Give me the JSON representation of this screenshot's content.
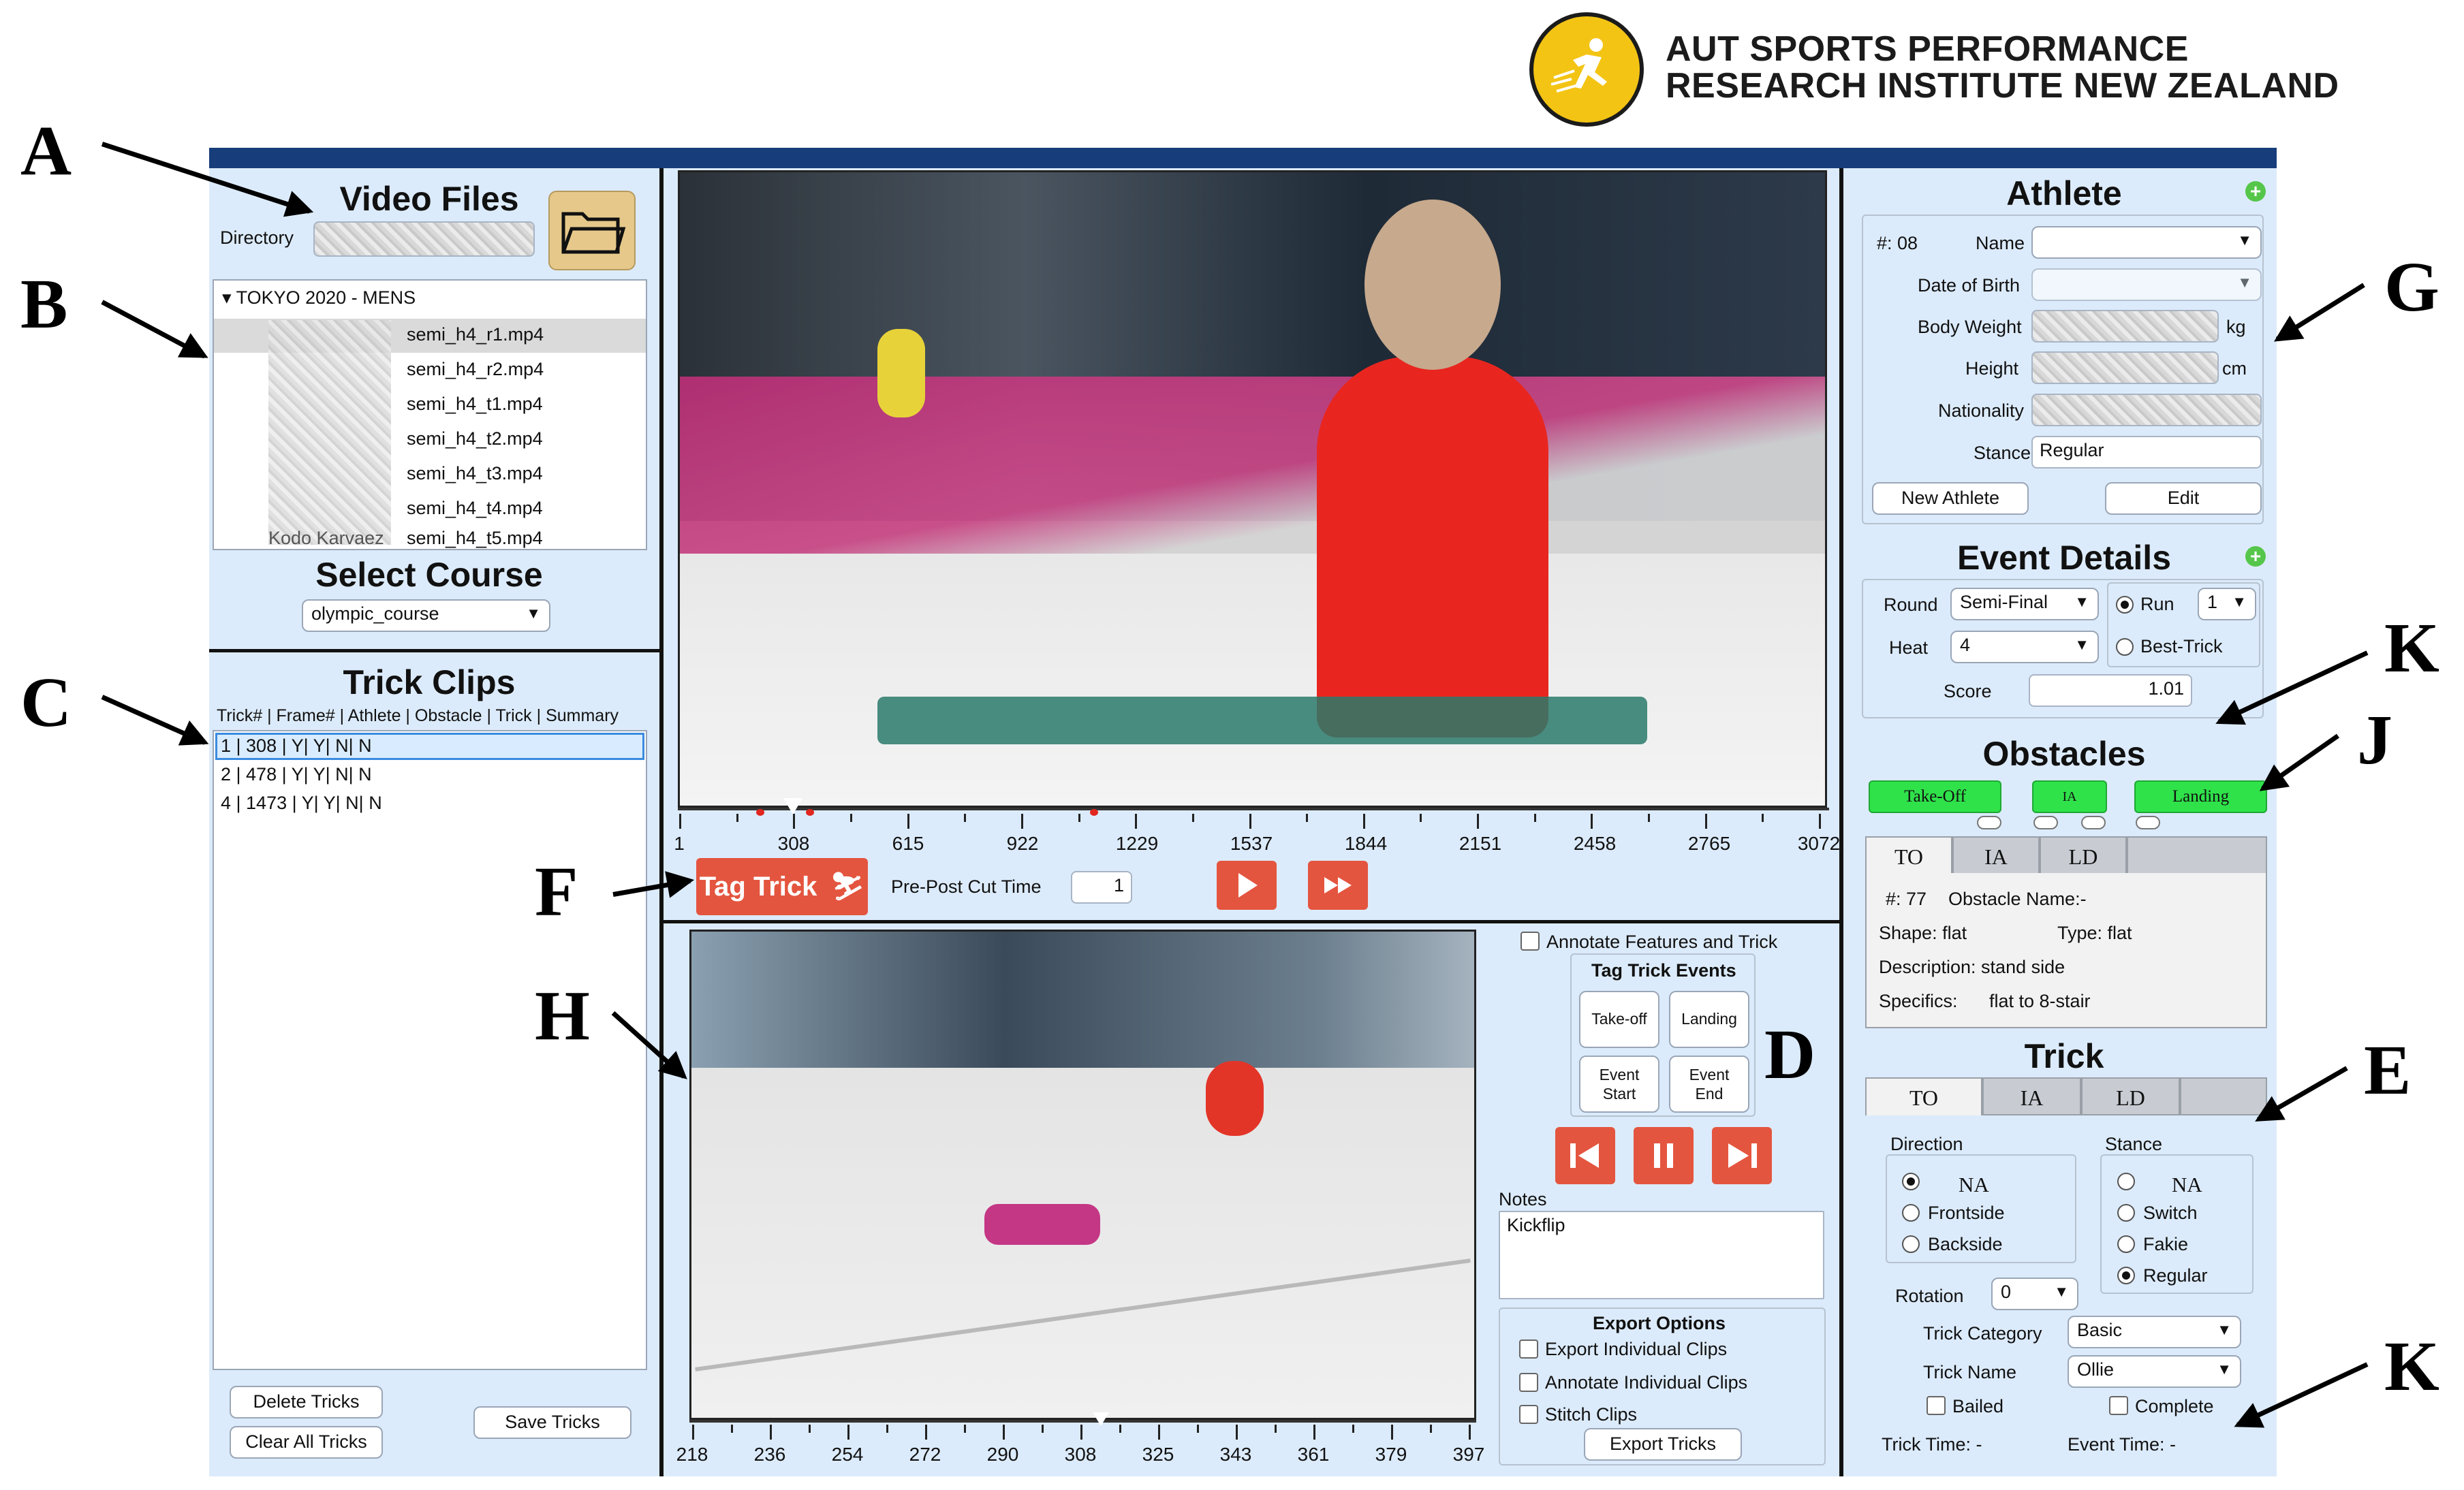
{
  "org": {
    "line1": "AUT SPORTS PERFORMANCE",
    "line2": "RESEARCH INSTITUTE NEW ZEALAND"
  },
  "annotations": {
    "A": "A",
    "B": "B",
    "C": "C",
    "D": "D",
    "E": "E",
    "F": "F",
    "G": "G",
    "H": "H",
    "J": "J",
    "K1": "K",
    "K2": "K"
  },
  "video_files": {
    "title": "Video Files",
    "directory_label": "Directory",
    "folder_group": "TOKYO 2020 - MENS",
    "files": [
      "semi_h4_r1.mp4",
      "semi_h4_r2.mp4",
      "semi_h4_t1.mp4",
      "semi_h4_t2.mp4",
      "semi_h4_t3.mp4",
      "semi_h4_t4.mp4",
      "semi_h4_t5.mp4"
    ],
    "partial_text": "Kodo Karvaez"
  },
  "course": {
    "title": "Select Course",
    "selected": "olympic_course"
  },
  "trick_clips": {
    "title": "Trick Clips",
    "header": "Trick# | Frame# | Athlete | Obstacle | Trick | Summary",
    "rows": [
      "1  |   308 |   Y|   Y|   N|   N",
      "2  |   478 |   Y|   Y|   N|   N",
      "4  |  1473 |   Y|   Y|   N|   N"
    ],
    "delete": "Delete Tricks",
    "clear": "Clear All Tricks",
    "save": "Save Tricks"
  },
  "timeline_top": {
    "labels": [
      "1",
      "308",
      "615",
      "922",
      "1229",
      "1537",
      "1844",
      "2151",
      "2458",
      "2765",
      "3072"
    ]
  },
  "tag_bar": {
    "tag_label": "Tag Trick",
    "cut_label": "Pre-Post Cut Time",
    "cut_value": "1"
  },
  "tag_events": {
    "annotate_label": "Annotate Features and Trick",
    "title": "Tag Trick Events",
    "takeoff": "Take-off",
    "landing": "Landing",
    "event_start": "Event\nStart",
    "event_end": "Event\nEnd"
  },
  "notes": {
    "label": "Notes",
    "value": "Kickflip"
  },
  "export": {
    "title": "Export Options",
    "opt1": "Export Individual Clips",
    "opt2": "Annotate Individual Clips",
    "opt3": "Stitch Clips",
    "button": "Export Tricks"
  },
  "timeline_bottom": {
    "labels": [
      "218",
      "236",
      "254",
      "272",
      "290",
      "308",
      "325",
      "343",
      "361",
      "379",
      "397"
    ]
  },
  "athlete": {
    "title": "Athlete",
    "number": "#: 08",
    "name_label": "Name",
    "dob_label": "Date of Birth",
    "weight_label": "Body Weight",
    "weight_unit": "kg",
    "height_label": "Height",
    "height_unit": "cm",
    "nationality_label": "Nationality",
    "stance_label": "Stance",
    "stance_value": "Regular",
    "new_btn": "New Athlete",
    "edit_btn": "Edit"
  },
  "event": {
    "title": "Event Details",
    "round_label": "Round",
    "round_value": "Semi-Final",
    "heat_label": "Heat",
    "heat_value": "4",
    "run_label": "Run",
    "run_value": "1",
    "best_label": "Best-Trick",
    "score_label": "Score",
    "score_value": "1.01"
  },
  "obstacles": {
    "title": "Obstacles",
    "takeoff": "Take-Off",
    "ia": "IA",
    "landing": "Landing",
    "tabs": [
      "TO",
      "IA",
      "LD"
    ],
    "number": "#: 77",
    "name_label": "Obstacle Name:-",
    "shape": "Shape: flat",
    "type": "Type: flat",
    "description": "Description: stand side",
    "specifics_label": "Specifics:",
    "specifics_value": "flat to 8-stair"
  },
  "trick": {
    "title": "Trick",
    "tabs": [
      "TO",
      "IA",
      "LD"
    ],
    "direction_label": "Direction",
    "direction_options": [
      "NA",
      "Frontside",
      "Backside"
    ],
    "stance_label": "Stance",
    "stance_options": [
      "NA",
      "Switch",
      "Fakie",
      "Regular"
    ],
    "rotation_label": "Rotation",
    "rotation_value": "0",
    "category_label": "Trick Category",
    "category_value": "Basic",
    "name_label": "Trick Name",
    "name_value": "Ollie",
    "bailed": "Bailed",
    "complete": "Complete",
    "trick_time": "Trick Time: -",
    "event_time": "Event Time: -"
  },
  "colors": {
    "accent_red": "#e4553f",
    "accent_green": "#2fe24a",
    "panel_bg": "#dcebfb",
    "topbar": "#173d7a",
    "logo_yellow": "#f3c414"
  }
}
